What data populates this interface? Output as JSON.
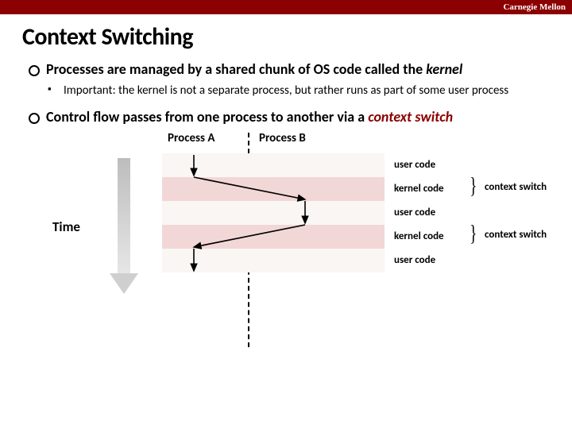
{
  "header": {
    "brand": "Carnegie Mellon"
  },
  "title": "Context Switching",
  "bullets": {
    "b1a_pre": "Processes are managed by a shared chunk of OS code called the ",
    "b1a_kernel": "kernel",
    "b2a": "Important: the kernel is not a separate process, but rather runs as part of some user process",
    "b1b_pre": "Control flow passes from one process to another via a ",
    "b1b_cs": "context switch"
  },
  "diagram": {
    "processA": "Process A",
    "processB": "Process B",
    "time": "Time",
    "bands": [
      {
        "label": "user code",
        "color": "pale"
      },
      {
        "label": "kernel code",
        "color": "pink"
      },
      {
        "label": "user code",
        "color": "pale"
      },
      {
        "label": "kernel code",
        "color": "pink"
      },
      {
        "label": "user code",
        "color": "pale"
      }
    ],
    "switch_label": "context switch"
  }
}
